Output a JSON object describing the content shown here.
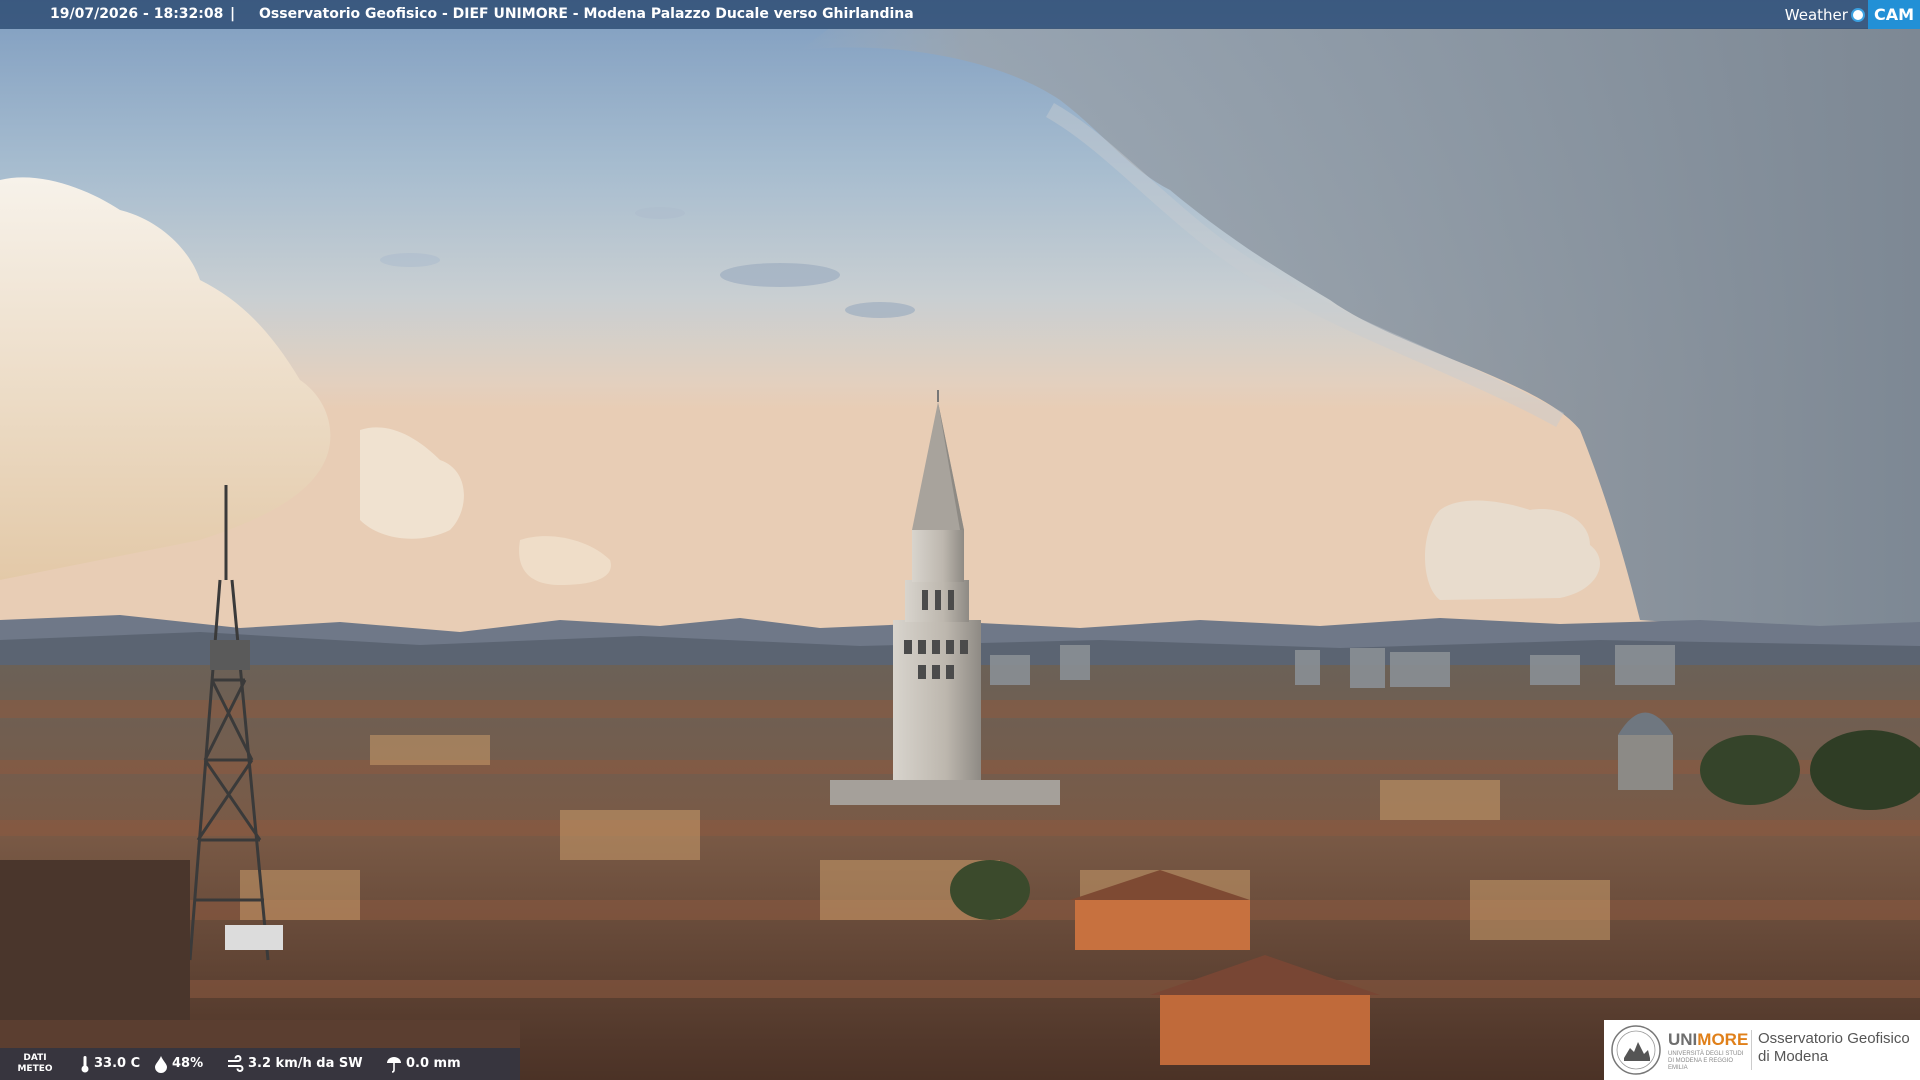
{
  "topbar": {
    "timestamp": "19/07/2026 - 18:32:08",
    "separator": "|",
    "location": "Osservatorio Geofisico - DIEF UNIMORE - Modena Palazzo Ducale verso Ghirlandina"
  },
  "brand": {
    "weather": "Weather",
    "cam": "CAM"
  },
  "weather": {
    "label_line1": "DATI",
    "label_line2": "METEO",
    "temperature": "33.0 C",
    "humidity": "48%",
    "wind": "3.2 km/h da SW",
    "rain": "0.0 mm"
  },
  "logo": {
    "uni_part1": "UNI",
    "uni_part2": "MORE",
    "uni_sub": "UNIVERSITÀ DEGLI STUDI DI MODENA E REGGIO EMILIA",
    "observatory_line1": "Osservatorio Geofisico",
    "observatory_line2": "di Modena"
  },
  "colors": {
    "bar": "#28466e",
    "cam_accent": "#2290d6",
    "unimore_orange": "#e0801a"
  }
}
